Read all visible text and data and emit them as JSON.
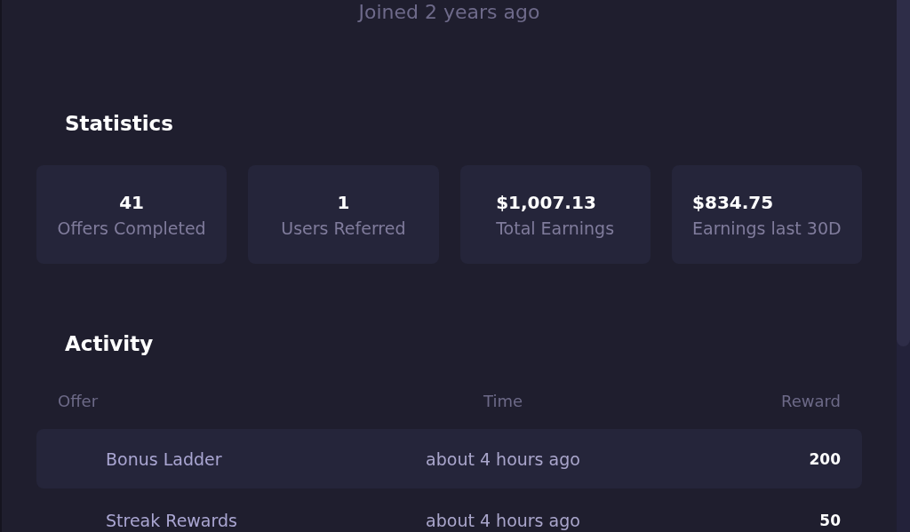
{
  "profile": {
    "joined": "Joined 2 years ago"
  },
  "statistics": {
    "title": "Statistics",
    "cards": [
      {
        "kind": "count",
        "value": "41",
        "label": "Offers Completed"
      },
      {
        "kind": "count",
        "value": "1",
        "label": "Users Referred"
      },
      {
        "kind": "amount",
        "value": "$1,007.13",
        "label": "Total Earnings"
      },
      {
        "kind": "amount",
        "value": "$834.75",
        "label": "Earnings last 30D"
      }
    ]
  },
  "activity": {
    "title": "Activity",
    "columns": [
      "Offer",
      "Time",
      "Reward"
    ],
    "rows": [
      {
        "offer": "Bonus Ladder",
        "time": "about 4 hours ago",
        "reward": "200"
      },
      {
        "offer": "Streak Rewards",
        "time": "about 4 hours ago",
        "reward": "50"
      }
    ]
  }
}
